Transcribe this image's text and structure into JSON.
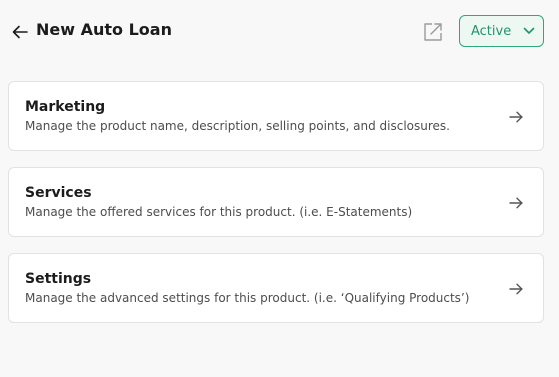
{
  "header": {
    "title": "New Auto Loan",
    "back_icon": "arrow-left-icon",
    "external_icon": "external-link-icon",
    "status": {
      "label": "Active",
      "icon": "chevron-down-icon"
    }
  },
  "colors": {
    "accent": "#2ea77a",
    "accent_bg": "#eef8f3",
    "card_border": "#e2e2e4",
    "page_bg": "#f8f8f9"
  },
  "cards": [
    {
      "title": "Marketing",
      "description": "Manage the product name, description, selling points, and disclosures.",
      "icon": "arrow-right-icon"
    },
    {
      "title": "Services",
      "description": "Manage the offered services for this product. (i.e. E-Statements)",
      "icon": "arrow-right-icon"
    },
    {
      "title": "Settings",
      "description": "Manage the advanced settings for this product. (i.e. ‘Qualifying Products’)",
      "icon": "arrow-right-icon"
    }
  ]
}
